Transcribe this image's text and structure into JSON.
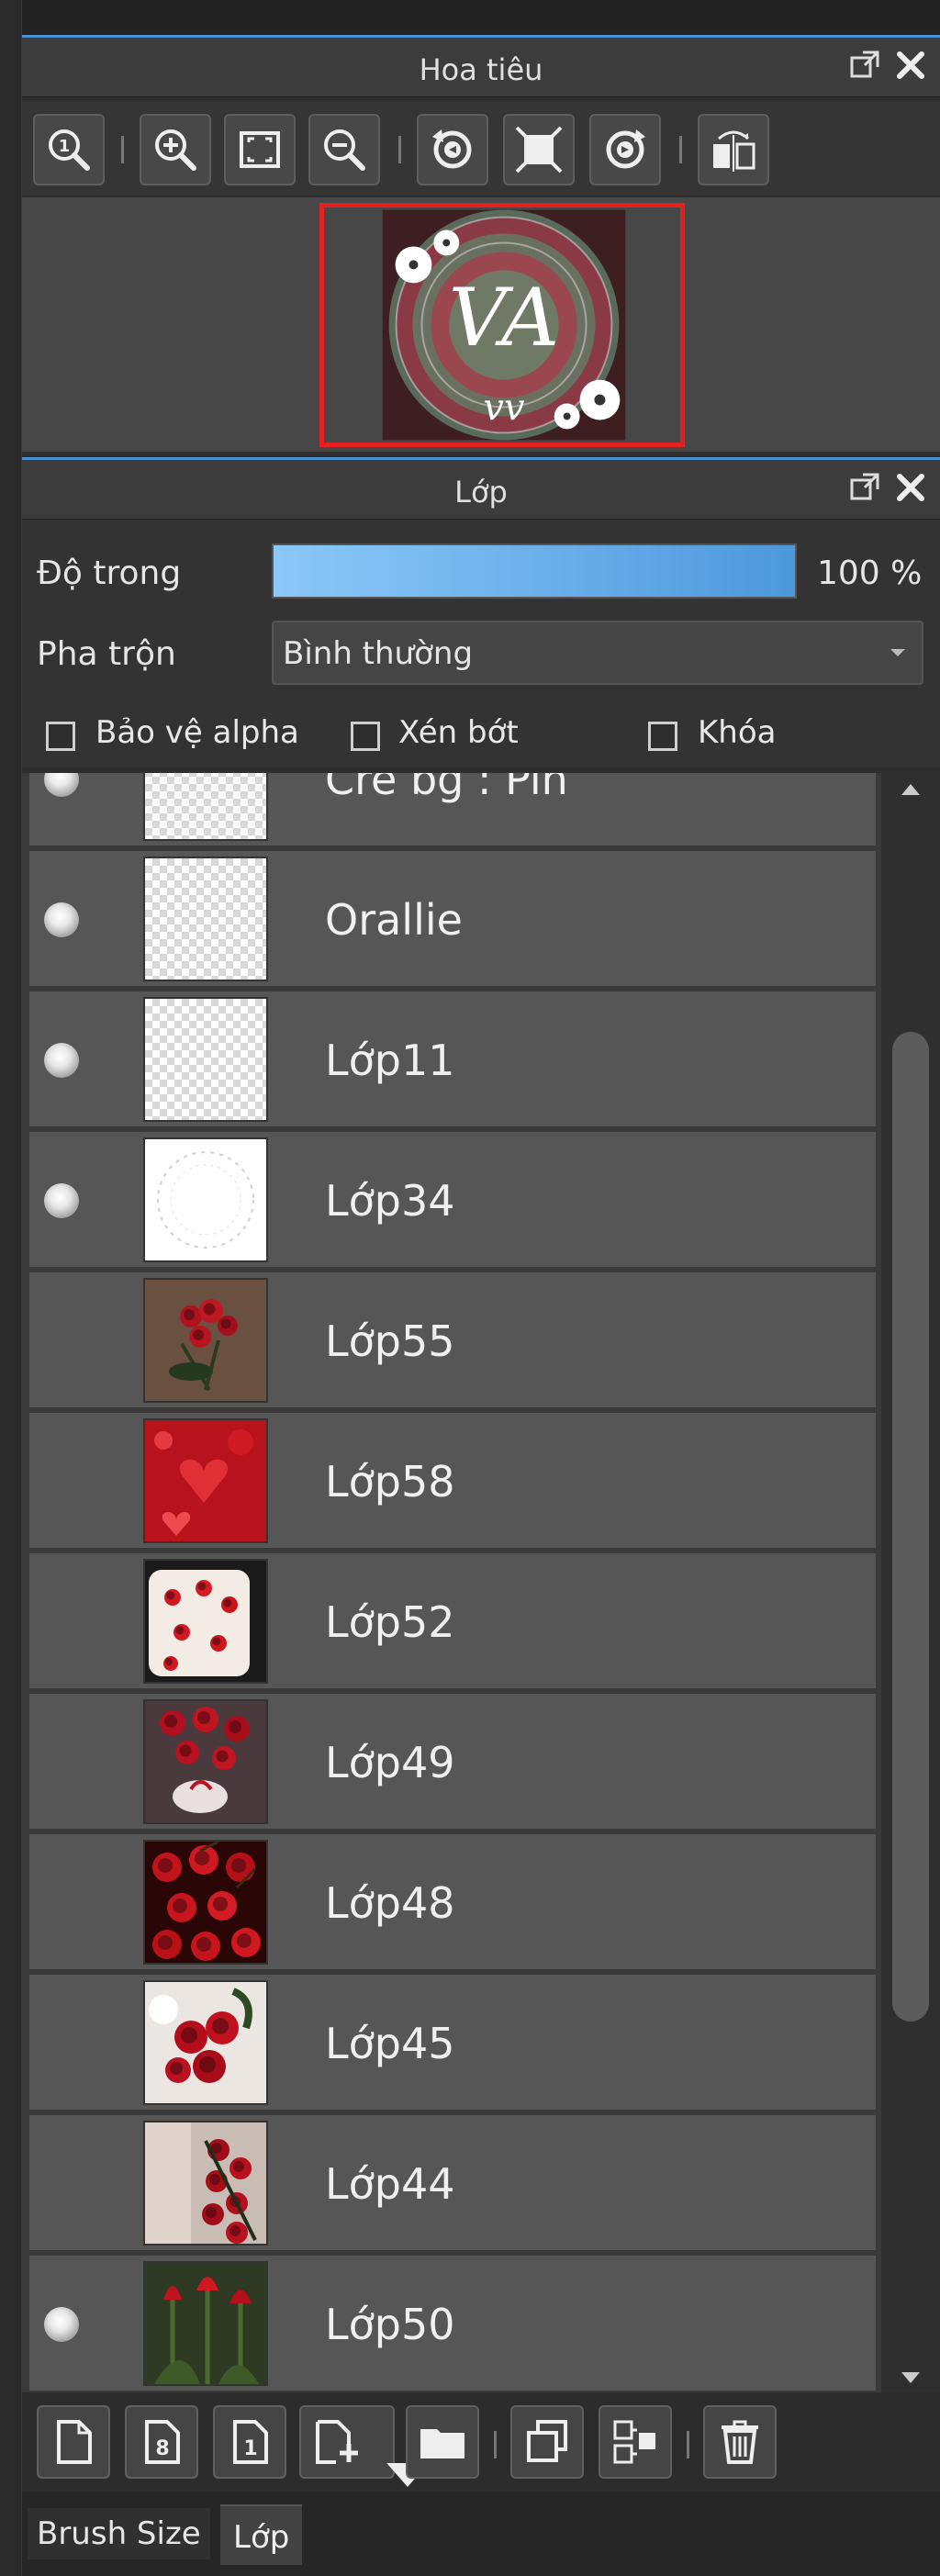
{
  "navigator": {
    "title": "Hoa tiêu",
    "toolbar_icons": [
      "zoom-fit-icon",
      "zoom-in-icon",
      "fullscreen-icon",
      "zoom-out-icon",
      "rotate-left-icon",
      "actual-size-icon",
      "rotate-right-icon",
      "flip-horizontal-icon"
    ]
  },
  "layers_panel": {
    "title": "Lớp",
    "opacity_label": "Độ trong",
    "opacity_value": "100 %",
    "opacity_fraction": 1.0,
    "blend_label": "Pha trộn",
    "blend_value": "Bình thường",
    "checkboxes": {
      "alpha": "Bảo vệ alpha",
      "clip": "Xén bớt",
      "lock": "Khóa"
    },
    "layers": [
      {
        "name": "Cre bg : Pin",
        "visible": true,
        "thumb": "checker"
      },
      {
        "name": "Orallie",
        "visible": true,
        "thumb": "checker"
      },
      {
        "name": "Lớp11",
        "visible": true,
        "thumb": "checker"
      },
      {
        "name": "Lớp34",
        "visible": true,
        "thumb": "ring"
      },
      {
        "name": "Lớp55",
        "visible": false,
        "thumb": "roses-dark"
      },
      {
        "name": "Lớp58",
        "visible": false,
        "thumb": "red-hearts"
      },
      {
        "name": "Lớp52",
        "visible": false,
        "thumb": "strawberry-cake"
      },
      {
        "name": "Lớp49",
        "visible": false,
        "thumb": "roses-bouquet"
      },
      {
        "name": "Lớp48",
        "visible": false,
        "thumb": "cherries"
      },
      {
        "name": "Lớp45",
        "visible": false,
        "thumb": "roses-white"
      },
      {
        "name": "Lớp44",
        "visible": false,
        "thumb": "roses-hand"
      },
      {
        "name": "Lớp50",
        "visible": true,
        "thumb": "tulips"
      }
    ]
  },
  "bottom_tabs": {
    "brush_size": "Brush Size",
    "layers": "Lớp"
  },
  "colors": {
    "accent": "#4a8fd0",
    "row_bg": "#565656",
    "panel_bg": "#3c3c3c",
    "nav_frame": "#e42020",
    "opacity_bar": "#5aaaf0"
  }
}
